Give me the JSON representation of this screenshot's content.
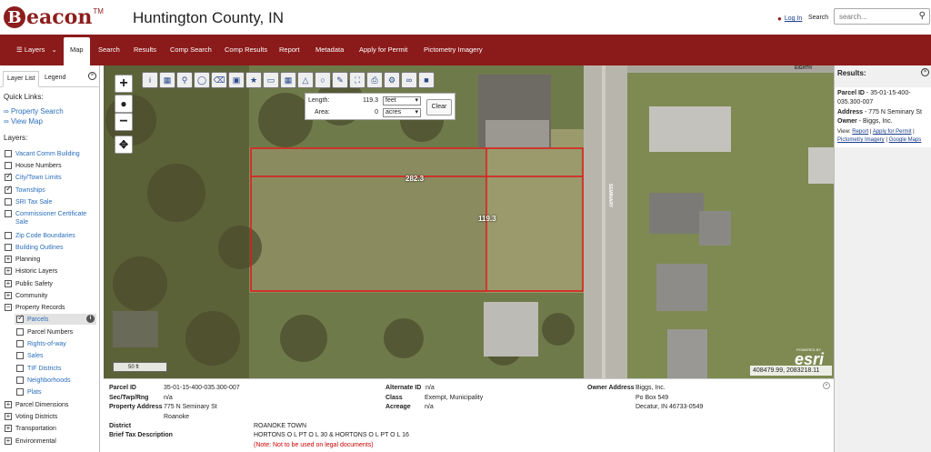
{
  "header": {
    "logo_letter": "B",
    "logo_text": "eacon",
    "logo_tm": "TM",
    "county": "Huntington County, IN",
    "login": "Log In",
    "search_label": "Search",
    "search_placeholder": "search..."
  },
  "nav": {
    "layers": "Layers",
    "map": "Map",
    "search": "Search",
    "results": "Results",
    "comp_search": "Comp Search",
    "comp_results": "Comp Results",
    "report": "Report",
    "metadata": "Metadata",
    "apply": "Apply for Permit",
    "pictometry": "Pictometry Imagery"
  },
  "left": {
    "tab_layer_list": "Layer List",
    "tab_legend": "Legend",
    "quick_links": "Quick Links:",
    "link_property_search": "Property Search",
    "link_view_map": "View Map",
    "layers_heading": "Layers:",
    "items": [
      "Vacant Comm Building",
      "House Numbers",
      "City/Town Limits",
      "Townships",
      "SRI Tax Sale",
      "Commissioner Certificate",
      "Sale",
      "Zip Code Boundaries",
      "Building Outlines",
      "Planning",
      "Historic Layers",
      "Public Safety",
      "Community",
      "Property Records",
      "Parcels",
      "Parcel Numbers",
      "Rights-of-way",
      "Sales",
      "TIF Districts",
      "Neighborhoods",
      "Plats",
      "Parcel Dimensions",
      "Voting Districts",
      "Transportation",
      "Environmental"
    ]
  },
  "map": {
    "measure_length_label": "Length:",
    "measure_length_value": "119.3",
    "measure_length_unit": "feet",
    "measure_area_label": "Area:",
    "measure_area_value": "0",
    "measure_area_unit": "acres",
    "clear": "Clear",
    "dim_top": "282.3",
    "dim_right": "119.3",
    "street_seminary": "SEMINARY",
    "street_eighth": "EIGHTH",
    "scale": "50 ft",
    "coords": "408479.99, 2083218.11",
    "powered_by": "POWERED BY",
    "esri": "esri"
  },
  "info": {
    "parcel_id_label": "Parcel ID",
    "parcel_id": "35-01-15-400-035.300-007",
    "sec_label": "Sec/Twp/Rng",
    "sec": "n/a",
    "prop_addr_label": "Property Address",
    "prop_addr1": "775 N Seminary St",
    "prop_addr2": "Roanoke",
    "district_label": "District",
    "district": "ROANOKE TOWN",
    "tax_label": "Brief Tax Description",
    "tax": "HORTONS O L PT O L 30 & HORTONS O L PT O L 16",
    "tax_note": "(Note: Not to be used on legal documents)",
    "alt_id_label": "Alternate ID",
    "alt_id": "n/a",
    "class_label": "Class",
    "class": "Exempt, Municipality",
    "acreage_label": "Acreage",
    "acreage": "n/a",
    "owner_label": "Owner Address",
    "owner1": "Biggs, Inc.",
    "owner2": "Po Box 549",
    "owner3": "Decatur, IN 46733-0549"
  },
  "results": {
    "title": "Results:",
    "parcel_label": "Parcel ID",
    "parcel_line1": " - 35-01-15-400-",
    "parcel_line2": "035.300-007",
    "address_label": "Address",
    "address": " - 775 N Seminary St",
    "owner_label": "Owner",
    "owner": " - Biggs, Inc.",
    "view_label": "View:",
    "report": "Report",
    "apply": "Apply for Permit",
    "pictometry": "Pictometry Imagery",
    "google": "Google Maps"
  }
}
